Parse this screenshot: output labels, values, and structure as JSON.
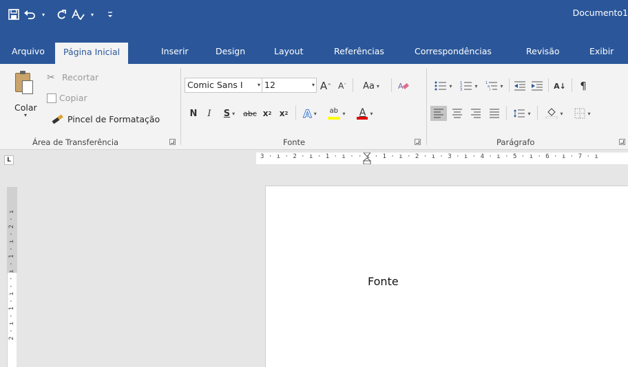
{
  "app": {
    "document_title": "Documento1",
    "colors": {
      "accent": "#2b579a",
      "ribbon_bg": "#f3f3f3",
      "workspace_bg": "#e6e6e6"
    }
  },
  "quick_access": {
    "icons": [
      "save-icon",
      "undo-icon",
      "redo-icon",
      "spelling-icon",
      "customize-qat-icon"
    ]
  },
  "tabs": [
    {
      "label": "Arquivo"
    },
    {
      "label": "Página Inicial",
      "active": true
    },
    {
      "label": "Inserir"
    },
    {
      "label": "Design"
    },
    {
      "label": "Layout"
    },
    {
      "label": "Referências"
    },
    {
      "label": "Correspondências"
    },
    {
      "label": "Revisão"
    },
    {
      "label": "Exibir"
    }
  ],
  "clipboard": {
    "group_label": "Área de Transferência",
    "paste_label": "Colar",
    "cut_label": "Recortar",
    "copy_label": "Copiar",
    "format_painter_label": "Pincel de Formatação"
  },
  "font": {
    "group_label": "Fonte",
    "font_name": "Comic Sans I",
    "font_size": "12",
    "grow_label": "A",
    "shrink_label": "A",
    "case_label": "Aa",
    "bold_label": "N",
    "italic_label": "I",
    "underline_label": "S",
    "strike_label": "abc",
    "subscript_label": "x",
    "subscript_mark": "2",
    "superscript_label": "x",
    "superscript_mark": "2",
    "effects_label": "A",
    "highlight_label": "ab",
    "color_label": "A",
    "highlight_color": "#ffff00",
    "font_color": "#e00000"
  },
  "paragraph": {
    "group_label": "Parágrafo",
    "sort_label": "A↓",
    "pilcrow": "¶"
  },
  "ruler": {
    "text": "3 · ı · 2 · ı · 1 · ı ·   · ı · 1 · ı · 2 · ı · 3 · ı · 4 · ı · 5 · ı · 6 · ı · 7 · ı",
    "tab_selector": "L"
  },
  "vertical_ruler": {
    "text": "2 · ı · 1 · ı · · ı · 1 · ı · 2 · ı"
  },
  "document": {
    "body_text": "Fonte"
  }
}
